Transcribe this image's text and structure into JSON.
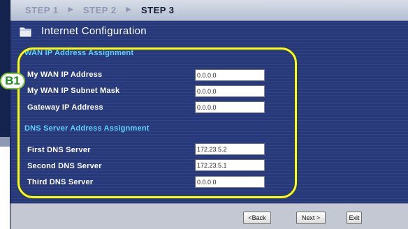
{
  "steps": [
    {
      "label": "STEP 1"
    },
    {
      "label": "STEP 2"
    },
    {
      "label": "STEP 3"
    }
  ],
  "title": "Internet Configuration",
  "wan_section": {
    "heading": "WAN IP Address Assignment",
    "fields": [
      {
        "label": "My WAN IP Address",
        "value": "0.0.0.0"
      },
      {
        "label": "My WAN IP Subnet Mask",
        "value": "0.0.0.0"
      },
      {
        "label": "Gateway IP Address",
        "value": "0.0.0.0"
      }
    ]
  },
  "dns_section": {
    "heading": "DNS Server Address Assignment",
    "fields": [
      {
        "label": "First DNS Server",
        "value": "172.23.5.2"
      },
      {
        "label": "Second DNS Server",
        "value": "172.23.5.1"
      },
      {
        "label": "Third DNS Server",
        "value": "0.0.0.0"
      }
    ]
  },
  "callout": "B1",
  "buttons": {
    "back": "<Back",
    "next": "Next >",
    "exit": "Exit"
  },
  "colors": {
    "panel": "#27397a",
    "section_heading": "#5fd1ff",
    "highlight": "#ffff00",
    "callout_text": "#1f8a1f"
  },
  "icons": {
    "title": "folder-icon",
    "step_separator": "triangle-right-icon"
  }
}
